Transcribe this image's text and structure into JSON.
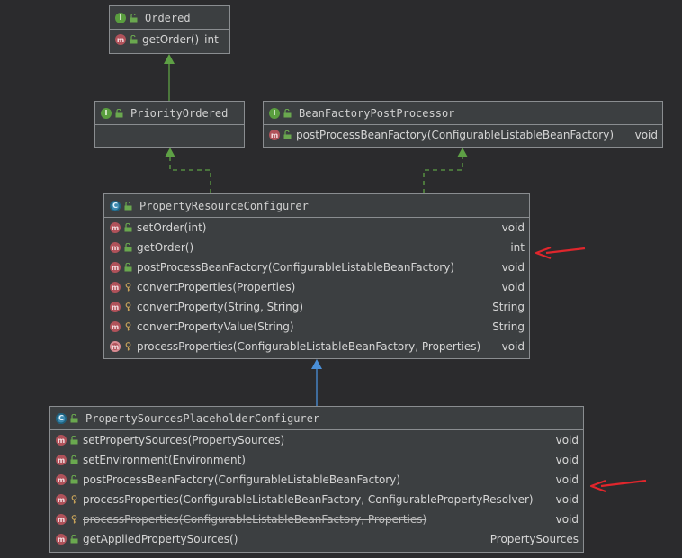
{
  "boxes": {
    "ordered": {
      "kind": "interface",
      "icon": "I",
      "title": "Ordered",
      "members": [
        {
          "icon": "m",
          "vis": "public",
          "sig": "getOrder()",
          "ret": "int"
        }
      ]
    },
    "priority_ordered": {
      "kind": "interface",
      "icon": "I",
      "title": "PriorityOrdered",
      "members": []
    },
    "bfpp": {
      "kind": "interface",
      "icon": "I",
      "title": "BeanFactoryPostProcessor",
      "members": [
        {
          "icon": "m",
          "vis": "public",
          "sig": "postProcessBeanFactory(ConfigurableListableBeanFactory)",
          "ret": "void"
        }
      ]
    },
    "prc": {
      "kind": "abstract-class",
      "icon": "C",
      "title": "PropertyResourceConfigurer",
      "members": [
        {
          "icon": "m",
          "vis": "public",
          "sig": "setOrder(int)",
          "ret": "void"
        },
        {
          "icon": "m",
          "vis": "public",
          "sig": "getOrder()",
          "ret": "int"
        },
        {
          "icon": "m",
          "vis": "public",
          "sig": "postProcessBeanFactory(ConfigurableListableBeanFactory)",
          "ret": "void"
        },
        {
          "icon": "m",
          "vis": "protected",
          "sig": "convertProperties(Properties)",
          "ret": "void"
        },
        {
          "icon": "m",
          "vis": "protected",
          "sig": "convertProperty(String, String)",
          "ret": "String"
        },
        {
          "icon": "m",
          "vis": "protected",
          "sig": "convertPropertyValue(String)",
          "ret": "String"
        },
        {
          "icon": "ma",
          "vis": "protected",
          "sig": "processProperties(ConfigurableListableBeanFactory, Properties)",
          "ret": "void"
        }
      ]
    },
    "pspc": {
      "kind": "class",
      "icon": "C",
      "title": "PropertySourcesPlaceholderConfigurer",
      "members": [
        {
          "icon": "m",
          "vis": "public",
          "sig": "setPropertySources(PropertySources)",
          "ret": "void"
        },
        {
          "icon": "m",
          "vis": "public",
          "sig": "setEnvironment(Environment)",
          "ret": "void"
        },
        {
          "icon": "m",
          "vis": "public",
          "sig": "postProcessBeanFactory(ConfigurableListableBeanFactory)",
          "ret": "void"
        },
        {
          "icon": "m",
          "vis": "protected",
          "sig": "processProperties(ConfigurableListableBeanFactory, ConfigurablePropertyResolver)",
          "ret": "void"
        },
        {
          "icon": "m",
          "vis": "protected",
          "sig": "processProperties(ConfigurableListableBeanFactory, Properties)",
          "ret": "void",
          "deprecated": true
        },
        {
          "icon": "m",
          "vis": "public",
          "sig": "getAppliedPropertySources()",
          "ret": "PropertySources"
        }
      ]
    }
  },
  "colors": {
    "background": "#2b2b2d",
    "node_fill": "#3c3f41",
    "node_border": "#8a8d90",
    "interface_icon": "#5a9e3f",
    "class_icon": "#3d8ab0",
    "method_icon": "#b0525a",
    "extends_arrow": "#4a8fd8",
    "implements_arrow": "#5ea045",
    "annotation_arrow": "#e0262c"
  }
}
